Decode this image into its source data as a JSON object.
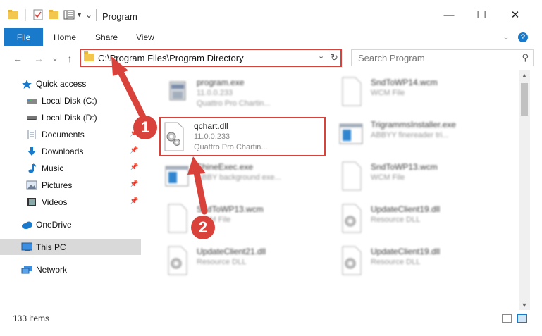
{
  "window": {
    "title": "Program",
    "minimize_glyph": "—",
    "maximize_glyph": "☐",
    "close_glyph": "✕"
  },
  "ribbon": {
    "tabs": [
      "File",
      "Home",
      "Share",
      "View"
    ],
    "expand_glyph": "⌄",
    "help_glyph": "?"
  },
  "address": {
    "path": "C:\\Program Files\\Program Directory",
    "dropdown_glyph": "⌄",
    "refresh_glyph": "↻"
  },
  "search": {
    "placeholder": "Search Program",
    "icon_glyph": "⚲"
  },
  "nav": {
    "back_glyph": "←",
    "forward_glyph": "→",
    "recent_glyph": "⌄",
    "up_glyph": "↑"
  },
  "sidebar": {
    "items": [
      {
        "label": "Quick access",
        "icon": "star-icon"
      },
      {
        "label": "Local Disk (C:)",
        "icon": "drive-icon"
      },
      {
        "label": "Local Disk (D:)",
        "icon": "drive-icon"
      },
      {
        "label": "Documents",
        "icon": "documents-icon"
      },
      {
        "label": "Downloads",
        "icon": "downloads-icon"
      },
      {
        "label": "Music",
        "icon": "music-icon"
      },
      {
        "label": "Pictures",
        "icon": "pictures-icon"
      },
      {
        "label": "Videos",
        "icon": "videos-icon"
      },
      {
        "label": "OneDrive",
        "icon": "cloud-icon"
      },
      {
        "label": "This PC",
        "icon": "computer-icon"
      },
      {
        "label": "Network",
        "icon": "network-icon"
      }
    ],
    "pin_glyph": "📌"
  },
  "files": [
    {
      "name": "program.exe",
      "line1": "11.0.0.233",
      "line2": "Quattro Pro Chartin...",
      "icon": "exe-icon"
    },
    {
      "name": "SndToWP14.wcm",
      "line1": "WCM File",
      "line2": "",
      "icon": "blank-file-icon"
    },
    {
      "name": "qchart.dll",
      "line1": "11.0.0.233",
      "line2": "Quattro Pro Chartin...",
      "icon": "dll-gear-icon"
    },
    {
      "name": "TrigrammsInstaller.exe",
      "line1": "ABBYY finereader tri...",
      "line2": "",
      "icon": "app-window-icon"
    },
    {
      "name": "ShineExec.exe",
      "line1": "ABBY background exe...",
      "line2": "",
      "icon": "app-window-icon"
    },
    {
      "name": "SndToWP13.wcm",
      "line1": "WCM File",
      "line2": "",
      "icon": "blank-file-icon"
    },
    {
      "name": "SndToWP13.wcm",
      "line1": "WCM File",
      "line2": "",
      "icon": "blank-file-icon"
    },
    {
      "name": "UpdateClient19.dll",
      "line1": "Resource DLL",
      "line2": "",
      "icon": "dll-gear-icon"
    },
    {
      "name": "UpdateClient21.dll",
      "line1": "Resource DLL",
      "line2": "",
      "icon": "dll-gear-icon"
    },
    {
      "name": "UpdateClient19.dll",
      "line1": "Resource DLL",
      "line2": "",
      "icon": "dll-gear-icon"
    }
  ],
  "status": {
    "item_count": "133 items"
  },
  "annotations": {
    "step1": "1",
    "step2": "2"
  },
  "colors": {
    "accent": "#1979ca",
    "annotation": "#d9413b",
    "folder": "#f3c74d"
  }
}
